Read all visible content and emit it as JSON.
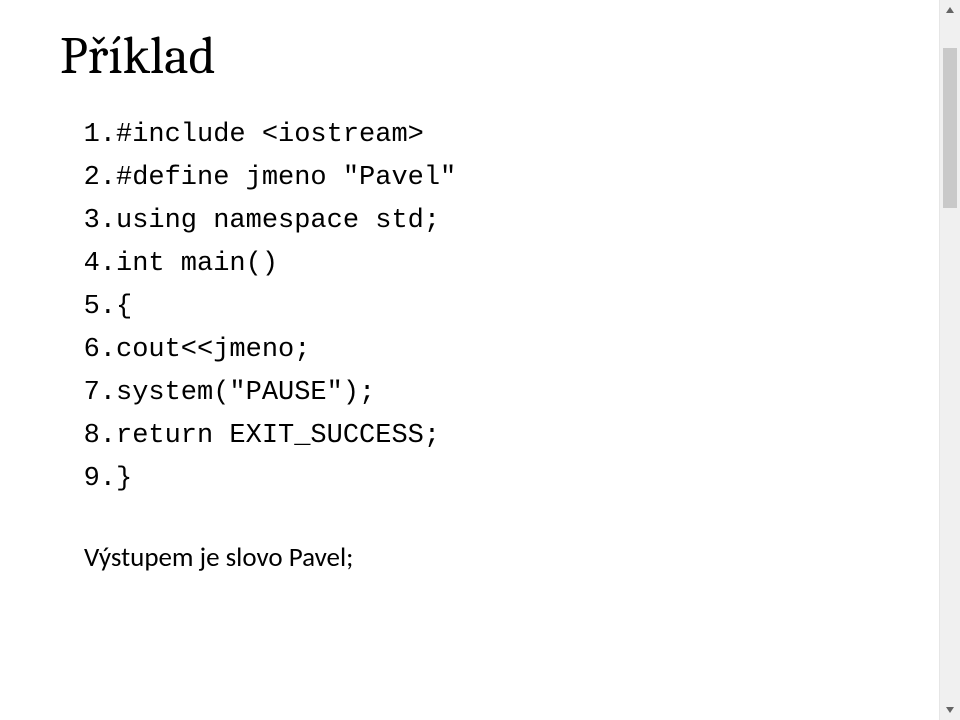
{
  "slide": {
    "title": "Příklad",
    "code_lines": [
      {
        "n": "1.",
        "text": "#include <iostream>"
      },
      {
        "n": "2.",
        "text": "#define jmeno \"Pavel\""
      },
      {
        "n": "3.",
        "text": "using namespace std;"
      },
      {
        "n": "4.",
        "text": "int main()"
      },
      {
        "n": "5.",
        "text": "{"
      },
      {
        "n": "6.",
        "text": "cout<<jmeno;"
      },
      {
        "n": "7.",
        "text": "system(\"PAUSE\");"
      },
      {
        "n": "8.",
        "text": "return EXIT_SUCCESS;"
      },
      {
        "n": "9.",
        "text": "}"
      }
    ],
    "output_text": "Výstupem je slovo Pavel;"
  }
}
